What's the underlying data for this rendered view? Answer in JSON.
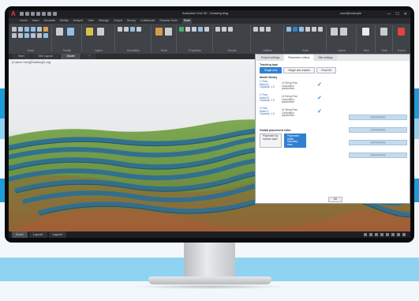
{
  "colors": {
    "accent_blue": "#2f80d1",
    "stripe_blue": "#1f9bd7",
    "stripe_light": "#8fd3f2",
    "terrain_green": "#5f8a3e",
    "panel_teal": "#2f6f91"
  },
  "app": {
    "logo": "A",
    "title": "Autodesk Civil 3D - Drawing.dwg",
    "user": "user@example",
    "window_buttons": [
      "—",
      "☐",
      "✕"
    ]
  },
  "ribbon": {
    "tabs": [
      "Home",
      "Insert",
      "Annotate",
      "Modify",
      "Analyze",
      "View",
      "Manage",
      "Output",
      "Survey",
      "Collaborate",
      "Express Tools",
      "Solar"
    ],
    "active_tab": "Solar",
    "groups": [
      "Draw",
      "Modify",
      "Layers",
      "Annotation",
      "Block",
      "Properties",
      "Groups",
      "Utilities",
      "Solar",
      "Layout",
      "View",
      "Tools",
      "Export"
    ]
  },
  "doc_tabs": [
    "Start",
    "Site Layout",
    "Model",
    "+"
  ],
  "viewport": {
    "label": "[Custom View][Realistic][X-ray]"
  },
  "dialog": {
    "tabs": [
      "Project settings",
      "Placement criteria",
      "Site settings"
    ],
    "active_tab": "Placement criteria",
    "heading": "Tracking type",
    "segments": [
      "Single axis",
      "Single axis tracker",
      "Fixed tilt"
    ],
    "active_segment": "Single axis",
    "section1_title": "Model library",
    "entries": [
      {
        "label": "1: Row\nModel A\nCapacity: 1.5",
        "desc": "1x String Row\nCalculation\nparameters"
      },
      {
        "label": "2: Row\nModel B\nCapacity: 1.5",
        "desc": "2x String Row\nCalculation\nparameters"
      },
      {
        "label": "3: Row\nModel C\nCapacity: 1.5",
        "desc": "3x String Row\nCalculation\nparameters"
      }
    ],
    "section2_title": "Global placement rules",
    "placement_buttons": [
      "Placement by\nsurface slope",
      "Placement within\nboundary area"
    ],
    "active_placement": 1,
    "bar_labels": [
      "||||||||||||||||||||||||",
      "||||||||||||||||||||||||",
      "||||||||||||||||||||||||",
      "||||||||||||||||||||||||"
    ],
    "ok_label": "OK"
  },
  "status": {
    "tabs": [
      "Model",
      "Layout1",
      "Layout2"
    ],
    "active_tab": "Model"
  }
}
